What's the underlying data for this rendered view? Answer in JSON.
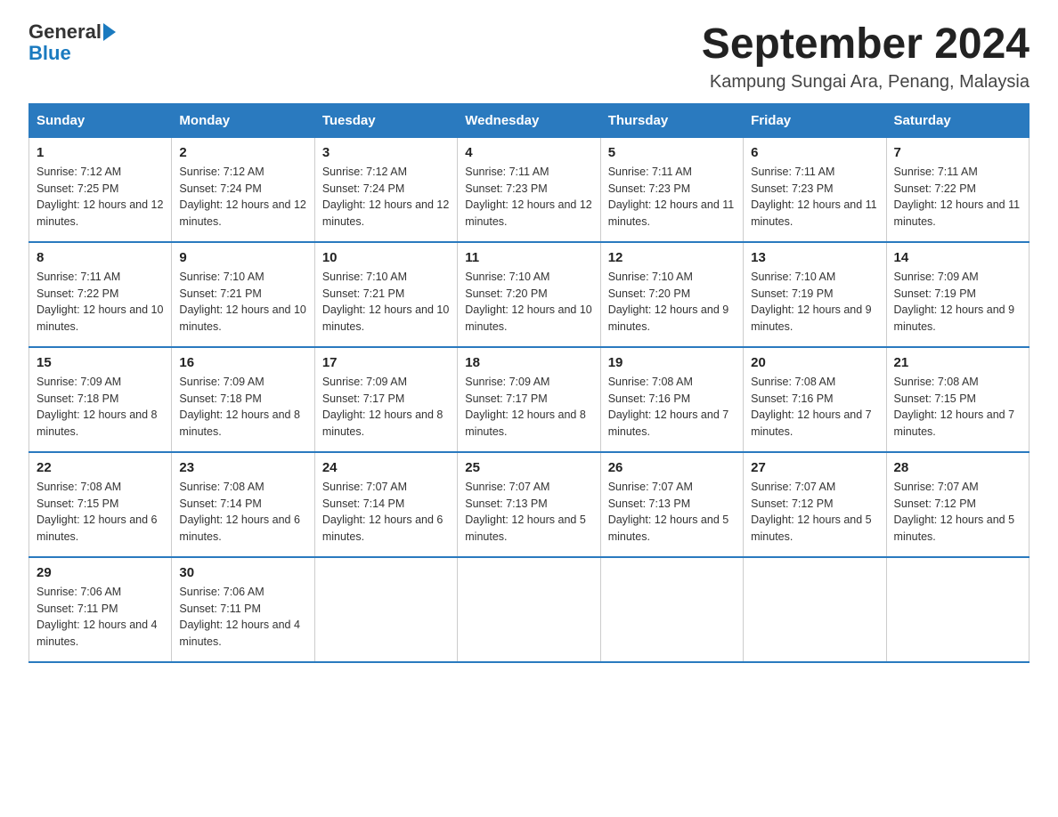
{
  "logo": {
    "text_general": "General",
    "text_blue": "Blue",
    "arrow_color": "#1a7abf"
  },
  "title": "September 2024",
  "subtitle": "Kampung Sungai Ara, Penang, Malaysia",
  "days_of_week": [
    "Sunday",
    "Monday",
    "Tuesday",
    "Wednesday",
    "Thursday",
    "Friday",
    "Saturday"
  ],
  "weeks": [
    [
      {
        "day": "1",
        "sunrise": "7:12 AM",
        "sunset": "7:25 PM",
        "daylight": "12 hours and 12 minutes."
      },
      {
        "day": "2",
        "sunrise": "7:12 AM",
        "sunset": "7:24 PM",
        "daylight": "12 hours and 12 minutes."
      },
      {
        "day": "3",
        "sunrise": "7:12 AM",
        "sunset": "7:24 PM",
        "daylight": "12 hours and 12 minutes."
      },
      {
        "day": "4",
        "sunrise": "7:11 AM",
        "sunset": "7:23 PM",
        "daylight": "12 hours and 12 minutes."
      },
      {
        "day": "5",
        "sunrise": "7:11 AM",
        "sunset": "7:23 PM",
        "daylight": "12 hours and 11 minutes."
      },
      {
        "day": "6",
        "sunrise": "7:11 AM",
        "sunset": "7:23 PM",
        "daylight": "12 hours and 11 minutes."
      },
      {
        "day": "7",
        "sunrise": "7:11 AM",
        "sunset": "7:22 PM",
        "daylight": "12 hours and 11 minutes."
      }
    ],
    [
      {
        "day": "8",
        "sunrise": "7:11 AM",
        "sunset": "7:22 PM",
        "daylight": "12 hours and 10 minutes."
      },
      {
        "day": "9",
        "sunrise": "7:10 AM",
        "sunset": "7:21 PM",
        "daylight": "12 hours and 10 minutes."
      },
      {
        "day": "10",
        "sunrise": "7:10 AM",
        "sunset": "7:21 PM",
        "daylight": "12 hours and 10 minutes."
      },
      {
        "day": "11",
        "sunrise": "7:10 AM",
        "sunset": "7:20 PM",
        "daylight": "12 hours and 10 minutes."
      },
      {
        "day": "12",
        "sunrise": "7:10 AM",
        "sunset": "7:20 PM",
        "daylight": "12 hours and 9 minutes."
      },
      {
        "day": "13",
        "sunrise": "7:10 AM",
        "sunset": "7:19 PM",
        "daylight": "12 hours and 9 minutes."
      },
      {
        "day": "14",
        "sunrise": "7:09 AM",
        "sunset": "7:19 PM",
        "daylight": "12 hours and 9 minutes."
      }
    ],
    [
      {
        "day": "15",
        "sunrise": "7:09 AM",
        "sunset": "7:18 PM",
        "daylight": "12 hours and 8 minutes."
      },
      {
        "day": "16",
        "sunrise": "7:09 AM",
        "sunset": "7:18 PM",
        "daylight": "12 hours and 8 minutes."
      },
      {
        "day": "17",
        "sunrise": "7:09 AM",
        "sunset": "7:17 PM",
        "daylight": "12 hours and 8 minutes."
      },
      {
        "day": "18",
        "sunrise": "7:09 AM",
        "sunset": "7:17 PM",
        "daylight": "12 hours and 8 minutes."
      },
      {
        "day": "19",
        "sunrise": "7:08 AM",
        "sunset": "7:16 PM",
        "daylight": "12 hours and 7 minutes."
      },
      {
        "day": "20",
        "sunrise": "7:08 AM",
        "sunset": "7:16 PM",
        "daylight": "12 hours and 7 minutes."
      },
      {
        "day": "21",
        "sunrise": "7:08 AM",
        "sunset": "7:15 PM",
        "daylight": "12 hours and 7 minutes."
      }
    ],
    [
      {
        "day": "22",
        "sunrise": "7:08 AM",
        "sunset": "7:15 PM",
        "daylight": "12 hours and 6 minutes."
      },
      {
        "day": "23",
        "sunrise": "7:08 AM",
        "sunset": "7:14 PM",
        "daylight": "12 hours and 6 minutes."
      },
      {
        "day": "24",
        "sunrise": "7:07 AM",
        "sunset": "7:14 PM",
        "daylight": "12 hours and 6 minutes."
      },
      {
        "day": "25",
        "sunrise": "7:07 AM",
        "sunset": "7:13 PM",
        "daylight": "12 hours and 5 minutes."
      },
      {
        "day": "26",
        "sunrise": "7:07 AM",
        "sunset": "7:13 PM",
        "daylight": "12 hours and 5 minutes."
      },
      {
        "day": "27",
        "sunrise": "7:07 AM",
        "sunset": "7:12 PM",
        "daylight": "12 hours and 5 minutes."
      },
      {
        "day": "28",
        "sunrise": "7:07 AM",
        "sunset": "7:12 PM",
        "daylight": "12 hours and 5 minutes."
      }
    ],
    [
      {
        "day": "29",
        "sunrise": "7:06 AM",
        "sunset": "7:11 PM",
        "daylight": "12 hours and 4 minutes."
      },
      {
        "day": "30",
        "sunrise": "7:06 AM",
        "sunset": "7:11 PM",
        "daylight": "12 hours and 4 minutes."
      },
      null,
      null,
      null,
      null,
      null
    ]
  ]
}
